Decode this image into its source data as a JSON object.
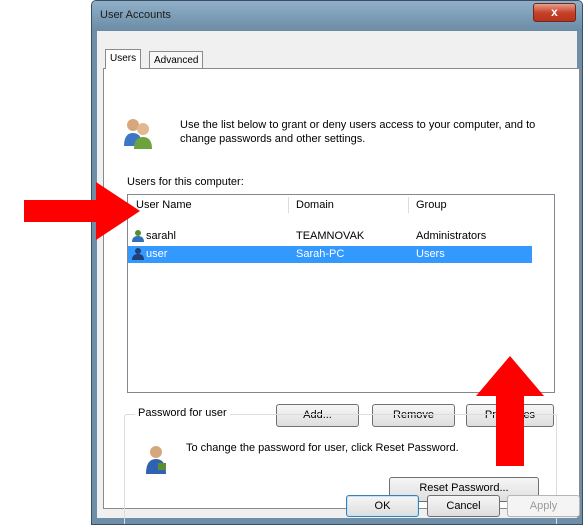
{
  "window": {
    "title": "User Accounts",
    "close_glyph": "x"
  },
  "tabs": [
    {
      "label": "Users",
      "active": true
    },
    {
      "label": "Advanced",
      "active": false
    }
  ],
  "intro": {
    "text": "Use the list below to grant or deny users access to your computer, and to change passwords and other settings."
  },
  "users_list": {
    "label": "Users for this computer:",
    "columns": [
      "User Name",
      "Domain",
      "Group"
    ],
    "rows": [
      {
        "name": "sarahl",
        "domain": "TEAMNOVAK",
        "group": "Administrators",
        "selected": false
      },
      {
        "name": "user",
        "domain": "Sarah-PC",
        "group": "Users",
        "selected": true
      }
    ]
  },
  "list_buttons": {
    "add": "Add...",
    "remove": "Remove",
    "properties": "Properties"
  },
  "password_group": {
    "title": "Password for user",
    "text": "To change the password for user, click Reset Password.",
    "reset_button": "Reset Password..."
  },
  "dialog_buttons": {
    "ok": "OK",
    "cancel": "Cancel",
    "apply": "Apply"
  },
  "colors": {
    "selection": "#3399ff",
    "annotation_arrow": "#ff0000",
    "title_bar": "#7a9bb5"
  },
  "icons": [
    "users-icon",
    "user-row-icon",
    "password-icon",
    "close-icon"
  ],
  "annotations": [
    "arrow pointing at selected user row",
    "arrow pointing at Properties button"
  ]
}
